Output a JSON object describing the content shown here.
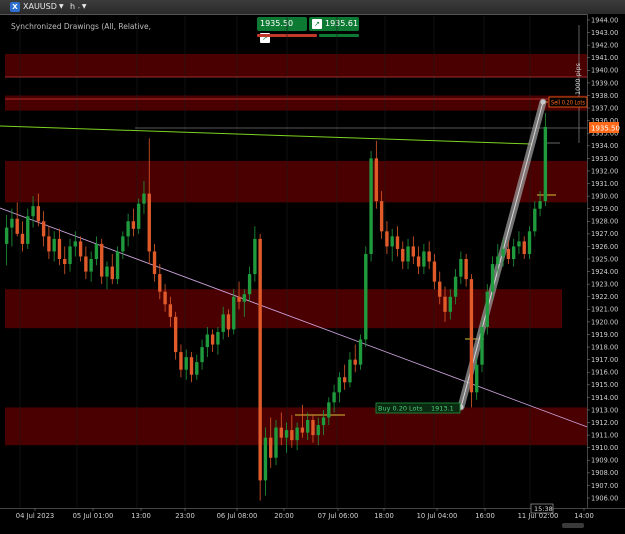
{
  "window": {
    "symbol": "XAUUSD",
    "logo": "X",
    "timeframe": "h"
  },
  "subtitle": "Synchronized Drawings (All, Relative,",
  "quotes": {
    "sell": "1935.50",
    "buy": "1935.61"
  },
  "colors": {
    "bull": "#1f9a3d",
    "bear": "#e05a2a",
    "zone": "#4a0000",
    "accent": "#ff6a1a"
  },
  "price_axis": {
    "labels": [
      "1944.00",
      "1943.00",
      "1942.00",
      "1941.00",
      "1940.00",
      "1939.00",
      "1938.00",
      "1937.00",
      "1936.00",
      "1935.00",
      "1934.00",
      "1933.00",
      "1932.00",
      "1931.00",
      "1930.00",
      "1929.00",
      "1928.00",
      "1927.00",
      "1926.00",
      "1925.00",
      "1924.00",
      "1923.00",
      "1922.00",
      "1921.00",
      "1920.00",
      "1919.00",
      "1918.00",
      "1917.00",
      "1916.00",
      "1915.00",
      "1914.00",
      "1913.00",
      "1912.00",
      "1911.00",
      "1910.00",
      "1909.00",
      "1908.00",
      "1907.00",
      "1906.00"
    ],
    "current": "1935.50",
    "range_label": "1000 pips"
  },
  "time_axis": {
    "labels": [
      "04 Jul 2023",
      "05 Jul 01:00",
      "13:00",
      "23:00",
      "06 Jul 08:00",
      "20:00",
      "07 Jul 06:00",
      "18:00",
      "10 Jul 04:00",
      "16:00",
      "11 Jul 02:00",
      "14:00"
    ],
    "cursor": "15:38"
  },
  "orders": {
    "sell_label": "Sell 0.20 Lots",
    "buy_label": "Buy 0.20 Lots",
    "buy_price": "1913.1"
  },
  "chart_data": {
    "type": "candlestick",
    "ylim": [
      1905.5,
      1944.5
    ],
    "x_count": 120,
    "zones": [
      [
        1939.5,
        1941.3
      ],
      [
        1936.8,
        1938.0
      ],
      [
        1929.5,
        1932.8
      ],
      [
        1919.5,
        1922.6
      ],
      [
        1910.2,
        1913.2
      ]
    ],
    "candles": [
      {
        "o": 1926.2,
        "h": 1928.5,
        "l": 1924.5,
        "c": 1927.5
      },
      {
        "o": 1927.5,
        "h": 1929.0,
        "l": 1926.0,
        "c": 1928.2
      },
      {
        "o": 1928.2,
        "h": 1929.5,
        "l": 1926.8,
        "c": 1927.0
      },
      {
        "o": 1927.0,
        "h": 1928.0,
        "l": 1925.6,
        "c": 1926.2
      },
      {
        "o": 1926.2,
        "h": 1929.0,
        "l": 1925.8,
        "c": 1928.4
      },
      {
        "o": 1928.4,
        "h": 1930.0,
        "l": 1927.5,
        "c": 1929.2
      },
      {
        "o": 1929.2,
        "h": 1930.2,
        "l": 1927.6,
        "c": 1928.0
      },
      {
        "o": 1928.0,
        "h": 1928.8,
        "l": 1926.0,
        "c": 1926.8
      },
      {
        "o": 1926.8,
        "h": 1927.6,
        "l": 1925.0,
        "c": 1925.6
      },
      {
        "o": 1925.6,
        "h": 1927.2,
        "l": 1924.8,
        "c": 1926.6
      },
      {
        "o": 1926.6,
        "h": 1927.4,
        "l": 1924.5,
        "c": 1925.0
      },
      {
        "o": 1925.0,
        "h": 1926.0,
        "l": 1923.8,
        "c": 1924.6
      },
      {
        "o": 1924.6,
        "h": 1926.6,
        "l": 1924.0,
        "c": 1926.0
      },
      {
        "o": 1926.0,
        "h": 1927.2,
        "l": 1925.2,
        "c": 1926.4
      },
      {
        "o": 1926.4,
        "h": 1926.8,
        "l": 1924.8,
        "c": 1925.2
      },
      {
        "o": 1925.2,
        "h": 1926.0,
        "l": 1923.4,
        "c": 1924.0
      },
      {
        "o": 1924.0,
        "h": 1925.6,
        "l": 1923.2,
        "c": 1925.0
      },
      {
        "o": 1925.0,
        "h": 1926.8,
        "l": 1924.5,
        "c": 1926.2
      },
      {
        "o": 1926.2,
        "h": 1926.6,
        "l": 1923.0,
        "c": 1923.6
      },
      {
        "o": 1923.6,
        "h": 1924.8,
        "l": 1922.6,
        "c": 1924.4
      },
      {
        "o": 1924.4,
        "h": 1925.4,
        "l": 1923.0,
        "c": 1923.4
      },
      {
        "o": 1923.4,
        "h": 1926.0,
        "l": 1923.0,
        "c": 1925.6
      },
      {
        "o": 1925.6,
        "h": 1927.2,
        "l": 1925.0,
        "c": 1926.8
      },
      {
        "o": 1926.8,
        "h": 1928.6,
        "l": 1926.0,
        "c": 1928.0
      },
      {
        "o": 1928.0,
        "h": 1929.0,
        "l": 1926.8,
        "c": 1927.4
      },
      {
        "o": 1927.4,
        "h": 1929.8,
        "l": 1927.0,
        "c": 1929.4
      },
      {
        "o": 1929.4,
        "h": 1931.2,
        "l": 1928.6,
        "c": 1930.2
      },
      {
        "o": 1930.2,
        "h": 1934.6,
        "l": 1924.6,
        "c": 1925.6
      },
      {
        "o": 1925.6,
        "h": 1926.2,
        "l": 1923.2,
        "c": 1923.8
      },
      {
        "o": 1923.8,
        "h": 1924.6,
        "l": 1921.8,
        "c": 1922.4
      },
      {
        "o": 1922.4,
        "h": 1923.0,
        "l": 1920.8,
        "c": 1921.4
      },
      {
        "o": 1921.4,
        "h": 1922.0,
        "l": 1919.6,
        "c": 1920.4
      },
      {
        "o": 1920.4,
        "h": 1920.8,
        "l": 1917.0,
        "c": 1917.6
      },
      {
        "o": 1917.6,
        "h": 1918.2,
        "l": 1915.6,
        "c": 1916.2
      },
      {
        "o": 1916.2,
        "h": 1917.8,
        "l": 1915.4,
        "c": 1917.2
      },
      {
        "o": 1917.2,
        "h": 1917.6,
        "l": 1915.2,
        "c": 1915.8
      },
      {
        "o": 1915.8,
        "h": 1917.4,
        "l": 1915.4,
        "c": 1916.8
      },
      {
        "o": 1916.8,
        "h": 1918.6,
        "l": 1916.2,
        "c": 1918.0
      },
      {
        "o": 1918.0,
        "h": 1919.6,
        "l": 1917.2,
        "c": 1919.0
      },
      {
        "o": 1919.0,
        "h": 1919.4,
        "l": 1917.6,
        "c": 1918.2
      },
      {
        "o": 1918.2,
        "h": 1919.6,
        "l": 1917.4,
        "c": 1919.2
      },
      {
        "o": 1919.2,
        "h": 1921.2,
        "l": 1918.6,
        "c": 1920.6
      },
      {
        "o": 1920.6,
        "h": 1921.0,
        "l": 1918.8,
        "c": 1919.4
      },
      {
        "o": 1919.4,
        "h": 1922.6,
        "l": 1919.0,
        "c": 1922.0
      },
      {
        "o": 1922.0,
        "h": 1923.2,
        "l": 1921.0,
        "c": 1921.6
      },
      {
        "o": 1921.6,
        "h": 1922.6,
        "l": 1920.4,
        "c": 1922.2
      },
      {
        "o": 1922.2,
        "h": 1924.4,
        "l": 1921.6,
        "c": 1923.8
      },
      {
        "o": 1923.8,
        "h": 1927.6,
        "l": 1923.2,
        "c": 1926.6
      },
      {
        "o": 1926.6,
        "h": 1927.0,
        "l": 1905.8,
        "c": 1907.4
      },
      {
        "o": 1907.4,
        "h": 1911.6,
        "l": 1906.2,
        "c": 1910.8
      },
      {
        "o": 1910.8,
        "h": 1912.4,
        "l": 1908.4,
        "c": 1909.2
      },
      {
        "o": 1909.2,
        "h": 1912.2,
        "l": 1908.6,
        "c": 1911.6
      },
      {
        "o": 1911.6,
        "h": 1912.8,
        "l": 1910.2,
        "c": 1910.8
      },
      {
        "o": 1910.8,
        "h": 1912.0,
        "l": 1909.6,
        "c": 1911.4
      },
      {
        "o": 1911.4,
        "h": 1912.6,
        "l": 1910.0,
        "c": 1910.6
      },
      {
        "o": 1910.6,
        "h": 1912.0,
        "l": 1909.8,
        "c": 1911.6
      },
      {
        "o": 1911.6,
        "h": 1913.4,
        "l": 1910.8,
        "c": 1911.2
      },
      {
        "o": 1911.2,
        "h": 1912.8,
        "l": 1910.6,
        "c": 1912.2
      },
      {
        "o": 1912.2,
        "h": 1912.6,
        "l": 1910.4,
        "c": 1911.0
      },
      {
        "o": 1911.0,
        "h": 1912.4,
        "l": 1910.2,
        "c": 1911.8
      },
      {
        "o": 1911.8,
        "h": 1913.0,
        "l": 1911.0,
        "c": 1912.4
      },
      {
        "o": 1912.4,
        "h": 1914.0,
        "l": 1911.8,
        "c": 1913.6
      },
      {
        "o": 1913.6,
        "h": 1915.0,
        "l": 1912.8,
        "c": 1914.4
      },
      {
        "o": 1914.4,
        "h": 1916.0,
        "l": 1913.6,
        "c": 1915.6
      },
      {
        "o": 1915.6,
        "h": 1916.6,
        "l": 1914.6,
        "c": 1915.2
      },
      {
        "o": 1915.2,
        "h": 1917.6,
        "l": 1914.8,
        "c": 1917.0
      },
      {
        "o": 1917.0,
        "h": 1918.2,
        "l": 1916.0,
        "c": 1916.6
      },
      {
        "o": 1916.6,
        "h": 1919.0,
        "l": 1916.2,
        "c": 1918.6
      },
      {
        "o": 1918.6,
        "h": 1926.0,
        "l": 1918.0,
        "c": 1925.4
      },
      {
        "o": 1925.4,
        "h": 1933.6,
        "l": 1924.8,
        "c": 1933.0
      },
      {
        "o": 1933.0,
        "h": 1934.4,
        "l": 1929.0,
        "c": 1929.6
      },
      {
        "o": 1929.6,
        "h": 1930.4,
        "l": 1926.6,
        "c": 1927.2
      },
      {
        "o": 1927.2,
        "h": 1928.0,
        "l": 1925.4,
        "c": 1926.0
      },
      {
        "o": 1926.0,
        "h": 1927.4,
        "l": 1924.8,
        "c": 1926.8
      },
      {
        "o": 1926.8,
        "h": 1927.6,
        "l": 1925.2,
        "c": 1925.8
      },
      {
        "o": 1925.8,
        "h": 1926.4,
        "l": 1924.2,
        "c": 1924.8
      },
      {
        "o": 1924.8,
        "h": 1926.6,
        "l": 1924.2,
        "c": 1926.0
      },
      {
        "o": 1926.0,
        "h": 1926.8,
        "l": 1924.6,
        "c": 1925.2
      },
      {
        "o": 1925.2,
        "h": 1926.0,
        "l": 1923.8,
        "c": 1924.4
      },
      {
        "o": 1924.4,
        "h": 1926.2,
        "l": 1923.8,
        "c": 1925.6
      },
      {
        "o": 1925.6,
        "h": 1926.4,
        "l": 1924.2,
        "c": 1924.8
      },
      {
        "o": 1924.8,
        "h": 1925.4,
        "l": 1922.6,
        "c": 1923.2
      },
      {
        "o": 1923.2,
        "h": 1924.0,
        "l": 1921.4,
        "c": 1922.0
      },
      {
        "o": 1922.0,
        "h": 1922.8,
        "l": 1920.0,
        "c": 1920.8
      },
      {
        "o": 1920.8,
        "h": 1922.6,
        "l": 1920.2,
        "c": 1922.0
      },
      {
        "o": 1922.0,
        "h": 1924.2,
        "l": 1921.4,
        "c": 1923.6
      },
      {
        "o": 1923.6,
        "h": 1925.6,
        "l": 1923.0,
        "c": 1925.0
      },
      {
        "o": 1925.0,
        "h": 1925.4,
        "l": 1922.8,
        "c": 1923.4
      },
      {
        "o": 1923.4,
        "h": 1923.8,
        "l": 1913.2,
        "c": 1914.4
      },
      {
        "o": 1914.4,
        "h": 1917.2,
        "l": 1913.8,
        "c": 1916.6
      },
      {
        "o": 1916.6,
        "h": 1920.2,
        "l": 1916.0,
        "c": 1919.6
      },
      {
        "o": 1919.6,
        "h": 1923.0,
        "l": 1919.0,
        "c": 1922.4
      },
      {
        "o": 1922.4,
        "h": 1925.2,
        "l": 1921.8,
        "c": 1924.6
      },
      {
        "o": 1924.6,
        "h": 1926.2,
        "l": 1923.8,
        "c": 1925.2
      },
      {
        "o": 1925.2,
        "h": 1926.6,
        "l": 1924.4,
        "c": 1925.8
      },
      {
        "o": 1925.8,
        "h": 1926.4,
        "l": 1924.6,
        "c": 1925.0
      },
      {
        "o": 1925.0,
        "h": 1926.6,
        "l": 1924.4,
        "c": 1926.0
      },
      {
        "o": 1926.0,
        "h": 1927.2,
        "l": 1925.4,
        "c": 1926.4
      },
      {
        "o": 1926.4,
        "h": 1926.8,
        "l": 1925.0,
        "c": 1925.4
      },
      {
        "o": 1925.4,
        "h": 1927.6,
        "l": 1925.0,
        "c": 1927.2
      },
      {
        "o": 1927.2,
        "h": 1929.6,
        "l": 1926.8,
        "c": 1929.0
      },
      {
        "o": 1929.0,
        "h": 1930.4,
        "l": 1928.4,
        "c": 1929.6
      },
      {
        "o": 1929.6,
        "h": 1936.6,
        "l": 1929.2,
        "c": 1935.5
      }
    ]
  }
}
